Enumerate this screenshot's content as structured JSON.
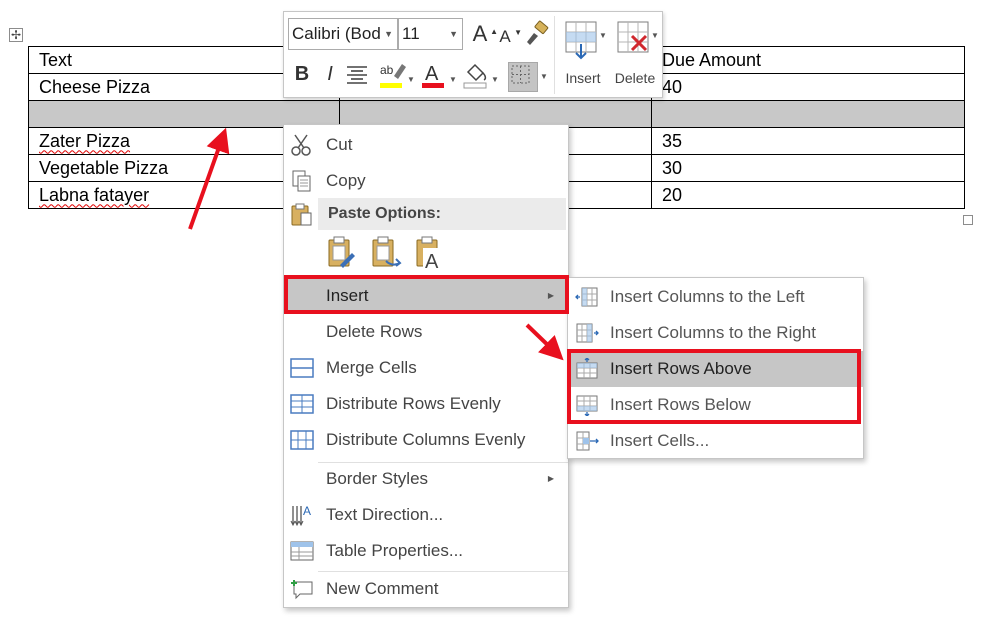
{
  "table": {
    "header": [
      "Text",
      "",
      "Due Amount"
    ],
    "rows": [
      [
        "Cheese Pizza",
        "",
        "40"
      ],
      [
        "",
        "",
        ""
      ],
      [
        "Zater Pizza",
        "",
        "35"
      ],
      [
        "Vegetable Pizza",
        "",
        "30"
      ],
      [
        "Labna fatayer",
        "",
        "20"
      ]
    ],
    "selected_row": 2
  },
  "mini_toolbar": {
    "font_name": "Calibri (Bod",
    "font_size": "11",
    "bold_label": "B",
    "italic_label": "I",
    "insert_label": "Insert",
    "delete_label": "Delete",
    "highlight_color": "#ffff00",
    "font_color": "#e8101e"
  },
  "context_menu": {
    "cut": "Cut",
    "copy": "Copy",
    "paste_options": "Paste Options:",
    "insert": "Insert",
    "delete_rows": "Delete Rows",
    "merge_cells": "Merge Cells",
    "distribute_rows": "Distribute Rows Evenly",
    "distribute_columns": "Distribute Columns Evenly",
    "border_styles": "Border Styles",
    "text_direction": "Text Direction...",
    "table_properties": "Table Properties...",
    "new_comment": "New Comment"
  },
  "insert_submenu": {
    "columns_left": "Insert Columns to the Left",
    "columns_right": "Insert Columns to the Right",
    "rows_above": "Insert Rows Above",
    "rows_below": "Insert Rows Below",
    "cells": "Insert Cells..."
  },
  "colors": {
    "annotation_red": "#e8101e",
    "selection_gray": "#c8c8c8",
    "menu_highlight": "#c6c6c6"
  }
}
